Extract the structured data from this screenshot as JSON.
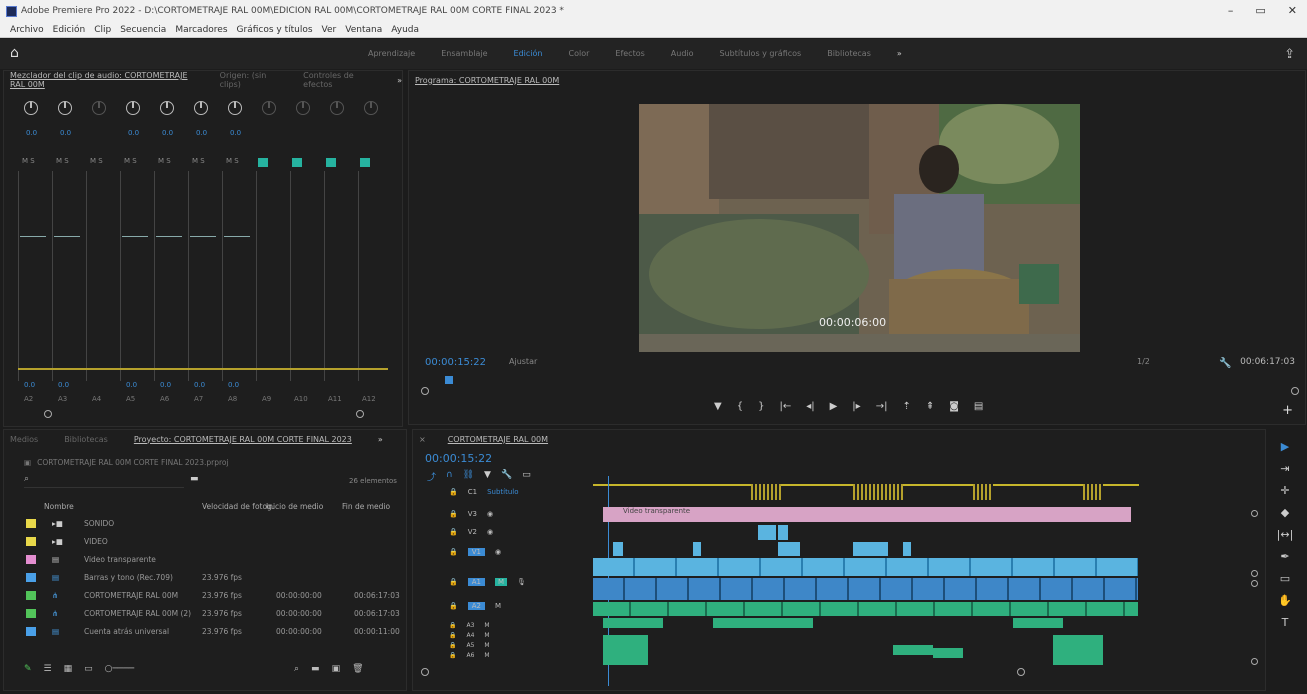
{
  "titlebar": {
    "title": "Adobe Premiere Pro 2022 - D:\\CORTOMETRAJE RAL 00M\\EDICION RAL 00M\\CORTOMETRAJE RAL 00M CORTE FINAL 2023 *",
    "minimize": "–",
    "restore": "▭",
    "close": "✕"
  },
  "menubar": [
    "Archivo",
    "Edición",
    "Clip",
    "Secuencia",
    "Marcadores",
    "Gráficos y títulos",
    "Ver",
    "Ventana",
    "Ayuda"
  ],
  "workspace": {
    "tabs": [
      "Aprendizaje",
      "Ensamblaje",
      "Edición",
      "Color",
      "Efectos",
      "Audio",
      "Subtítulos y gráficos",
      "Bibliotecas",
      "»"
    ],
    "active_tab": "Edición"
  },
  "mixer": {
    "tabs": [
      "Mezclador del clip de audio: CORTOMETRAJE RAL 00M",
      "Origen: (sin clips)",
      "Controles de efectos",
      "»"
    ],
    "levels": [
      "0.0",
      "0.0",
      "0.0",
      "0.0",
      "0.0",
      "0.0"
    ],
    "meter_db": [
      "0.0",
      "0.0",
      "0.0",
      "0.0",
      "0.0",
      "0.0"
    ],
    "tracks": [
      "A2",
      "A3",
      "A4",
      "A5",
      "A6",
      "A7",
      "A8",
      "A9",
      "A10",
      "A11",
      "A12"
    ]
  },
  "program": {
    "tab": "Programa: CORTOMETRAJE RAL 00M",
    "timecode": "00:00:15:22",
    "fit": "Ajustar",
    "ratio": "1/2",
    "duration": "00:06:17:03",
    "burnin_timecode": "00:00:06:00"
  },
  "project": {
    "tabs": [
      "Medios",
      "Bibliotecas",
      "Proyecto: CORTOMETRAJE RAL 00M CORTE FINAL 2023",
      "»"
    ],
    "project_file": "CORTOMETRAJE RAL 00M CORTE FINAL 2023.prproj",
    "item_count": "26 elementos",
    "columns": [
      "Nombre",
      "Velocidad de fotog.",
      "Inicio de medio",
      "Fin de medio"
    ],
    "rows": [
      {
        "name": "SONIDO",
        "color": "#e8d84a",
        "fps": "",
        "start": "",
        "end": ""
      },
      {
        "name": "VIDEO",
        "color": "#e8d84a",
        "fps": "",
        "start": "",
        "end": ""
      },
      {
        "name": "Video transparente",
        "color": "#e48ed0",
        "fps": "",
        "start": "",
        "end": ""
      },
      {
        "name": "Barras y tono (Rec.709)",
        "color": "#4aa0e8",
        "fps": "23.976 fps",
        "start": "",
        "end": ""
      },
      {
        "name": "CORTOMETRAJE RAL 00M",
        "color": "#52c45a",
        "fps": "23.976 fps",
        "start": "00:00:00:00",
        "end": "00:06:17:03"
      },
      {
        "name": "CORTOMETRAJE RAL 00M (2)",
        "color": "#52c45a",
        "fps": "23.976 fps",
        "start": "00:00:00:00",
        "end": "00:06:17:03"
      },
      {
        "name": "Cuenta atrás universal",
        "color": "#4aa0e8",
        "fps": "23.976 fps",
        "start": "00:00:00:00",
        "end": "00:00:11:00"
      }
    ]
  },
  "timeline": {
    "tab": "CORTOMETRAJE RAL 00M",
    "timecode": "00:00:15:22",
    "subtitle_track": "Subtítulo",
    "video_clip": "Video transparente",
    "video_tracks": [
      "V3",
      "V2",
      "V1"
    ],
    "audio_tracks": [
      "A1",
      "A2",
      "A3",
      "A4",
      "A5",
      "A6"
    ]
  }
}
